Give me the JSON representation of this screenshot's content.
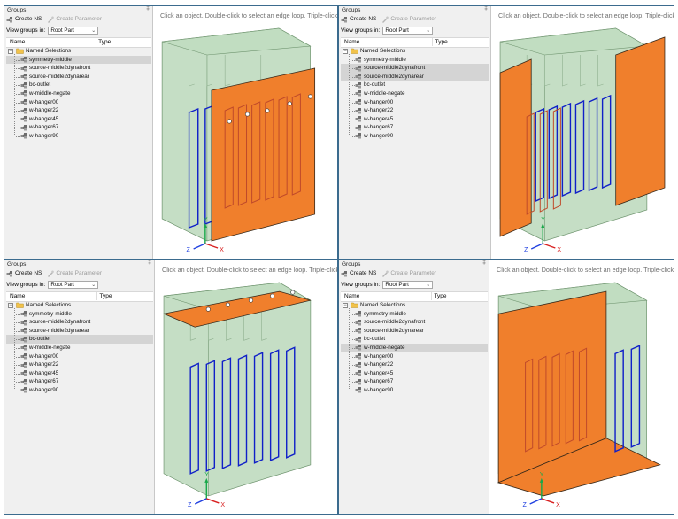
{
  "panels": [
    {
      "tree": {
        "title": "Groups",
        "pin": "‡",
        "create_ns": "Create NS",
        "create_parameter": "Create Parameter",
        "view_groups_label": "View groups in:",
        "view_groups_value": "Root Part",
        "col_name": "Name",
        "col_type": "Type",
        "root_label": "Named Selections",
        "items": [
          {
            "label": "symmetry-middle",
            "selected": true
          },
          {
            "label": "source-middle2dynafront",
            "selected": false
          },
          {
            "label": "source-middle2dynarear",
            "selected": false
          },
          {
            "label": "bc-outlet",
            "selected": false
          },
          {
            "label": "w-middle-negate",
            "selected": false
          },
          {
            "label": "w-hanger00",
            "selected": false
          },
          {
            "label": "w-hanger22",
            "selected": false
          },
          {
            "label": "w-hanger45",
            "selected": false
          },
          {
            "label": "w-hanger67",
            "selected": false
          },
          {
            "label": "w-hanger90",
            "selected": false
          }
        ]
      },
      "viewport": {
        "hint": "Click an object. Double-click to select an edge loop. Triple-click to s"
      },
      "highlight": "symmetry-middle"
    },
    {
      "tree": {
        "title": "Groups",
        "pin": "‡",
        "create_ns": "Create NS",
        "create_parameter": "Create Parameter",
        "view_groups_label": "View groups in:",
        "view_groups_value": "Root Part",
        "col_name": "Name",
        "col_type": "Type",
        "root_label": "Named Selections",
        "items": [
          {
            "label": "symmetry-middle",
            "selected": false
          },
          {
            "label": "source-middle2dynafront",
            "selected": true
          },
          {
            "label": "source-middle2dynarear",
            "selected": true
          },
          {
            "label": "bc-outlet",
            "selected": false
          },
          {
            "label": "w-middle-negate",
            "selected": false
          },
          {
            "label": "w-hanger00",
            "selected": false
          },
          {
            "label": "w-hanger22",
            "selected": false
          },
          {
            "label": "w-hanger45",
            "selected": false
          },
          {
            "label": "w-hanger67",
            "selected": false
          },
          {
            "label": "w-hanger90",
            "selected": false
          }
        ]
      },
      "viewport": {
        "hint": "Click an object. Double-click to select an edge loop. Triple-click to se"
      },
      "highlight": "sources"
    },
    {
      "tree": {
        "title": "Groups",
        "pin": "‡",
        "create_ns": "Create NS",
        "create_parameter": "Create Parameter",
        "view_groups_label": "View groups in:",
        "view_groups_value": "Root Part",
        "col_name": "Name",
        "col_type": "Type",
        "root_label": "Named Selections",
        "items": [
          {
            "label": "symmetry-middle",
            "selected": false
          },
          {
            "label": "source-middle2dynafront",
            "selected": false
          },
          {
            "label": "source-middle2dynarear",
            "selected": false
          },
          {
            "label": "bc-outlet",
            "selected": true
          },
          {
            "label": "w-middle-negate",
            "selected": false
          },
          {
            "label": "w-hanger00",
            "selected": false
          },
          {
            "label": "w-hanger22",
            "selected": false
          },
          {
            "label": "w-hanger45",
            "selected": false
          },
          {
            "label": "w-hanger67",
            "selected": false
          },
          {
            "label": "w-hanger90",
            "selected": false
          }
        ]
      },
      "viewport": {
        "hint": "Click an object. Double-click to select an edge loop. Triple-click to se"
      },
      "highlight": "bc-outlet"
    },
    {
      "tree": {
        "title": "Groups",
        "pin": "‡",
        "create_ns": "Create NS",
        "create_parameter": "Create Parameter",
        "view_groups_label": "View groups in:",
        "view_groups_value": "Root Part",
        "col_name": "Name",
        "col_type": "Type",
        "root_label": "Named Selections",
        "items": [
          {
            "label": "symmetry-middle",
            "selected": false
          },
          {
            "label": "source-middle2dynafront",
            "selected": false
          },
          {
            "label": "source-middle2dynarear",
            "selected": false
          },
          {
            "label": "bc-outlet",
            "selected": false
          },
          {
            "label": "w-middle-negate",
            "selected": true
          },
          {
            "label": "w-hanger00",
            "selected": false
          },
          {
            "label": "w-hanger22",
            "selected": false
          },
          {
            "label": "w-hanger45",
            "selected": false
          },
          {
            "label": "w-hanger67",
            "selected": false
          },
          {
            "label": "w-hanger90",
            "selected": false
          }
        ]
      },
      "viewport": {
        "hint": "Click an object. Double-click to select an edge loop. Triple-click to se"
      },
      "highlight": "w-middle-negate"
    }
  ],
  "axes": {
    "z": "Z",
    "y": "Y",
    "x": "X"
  },
  "icons": {
    "create_ns": "named-selection-icon",
    "create_parameter": "parameter-icon",
    "root": "folder-icon",
    "item": "named-selection-icon"
  },
  "colors": {
    "selected_face": "#f07f2c",
    "domain_face": "#b9d6b9",
    "hanger_blue": "#1020c8",
    "hanger_red": "#c04a2a",
    "selection_row": "#d4d4d4",
    "panel_border": "#3b6b8e"
  }
}
